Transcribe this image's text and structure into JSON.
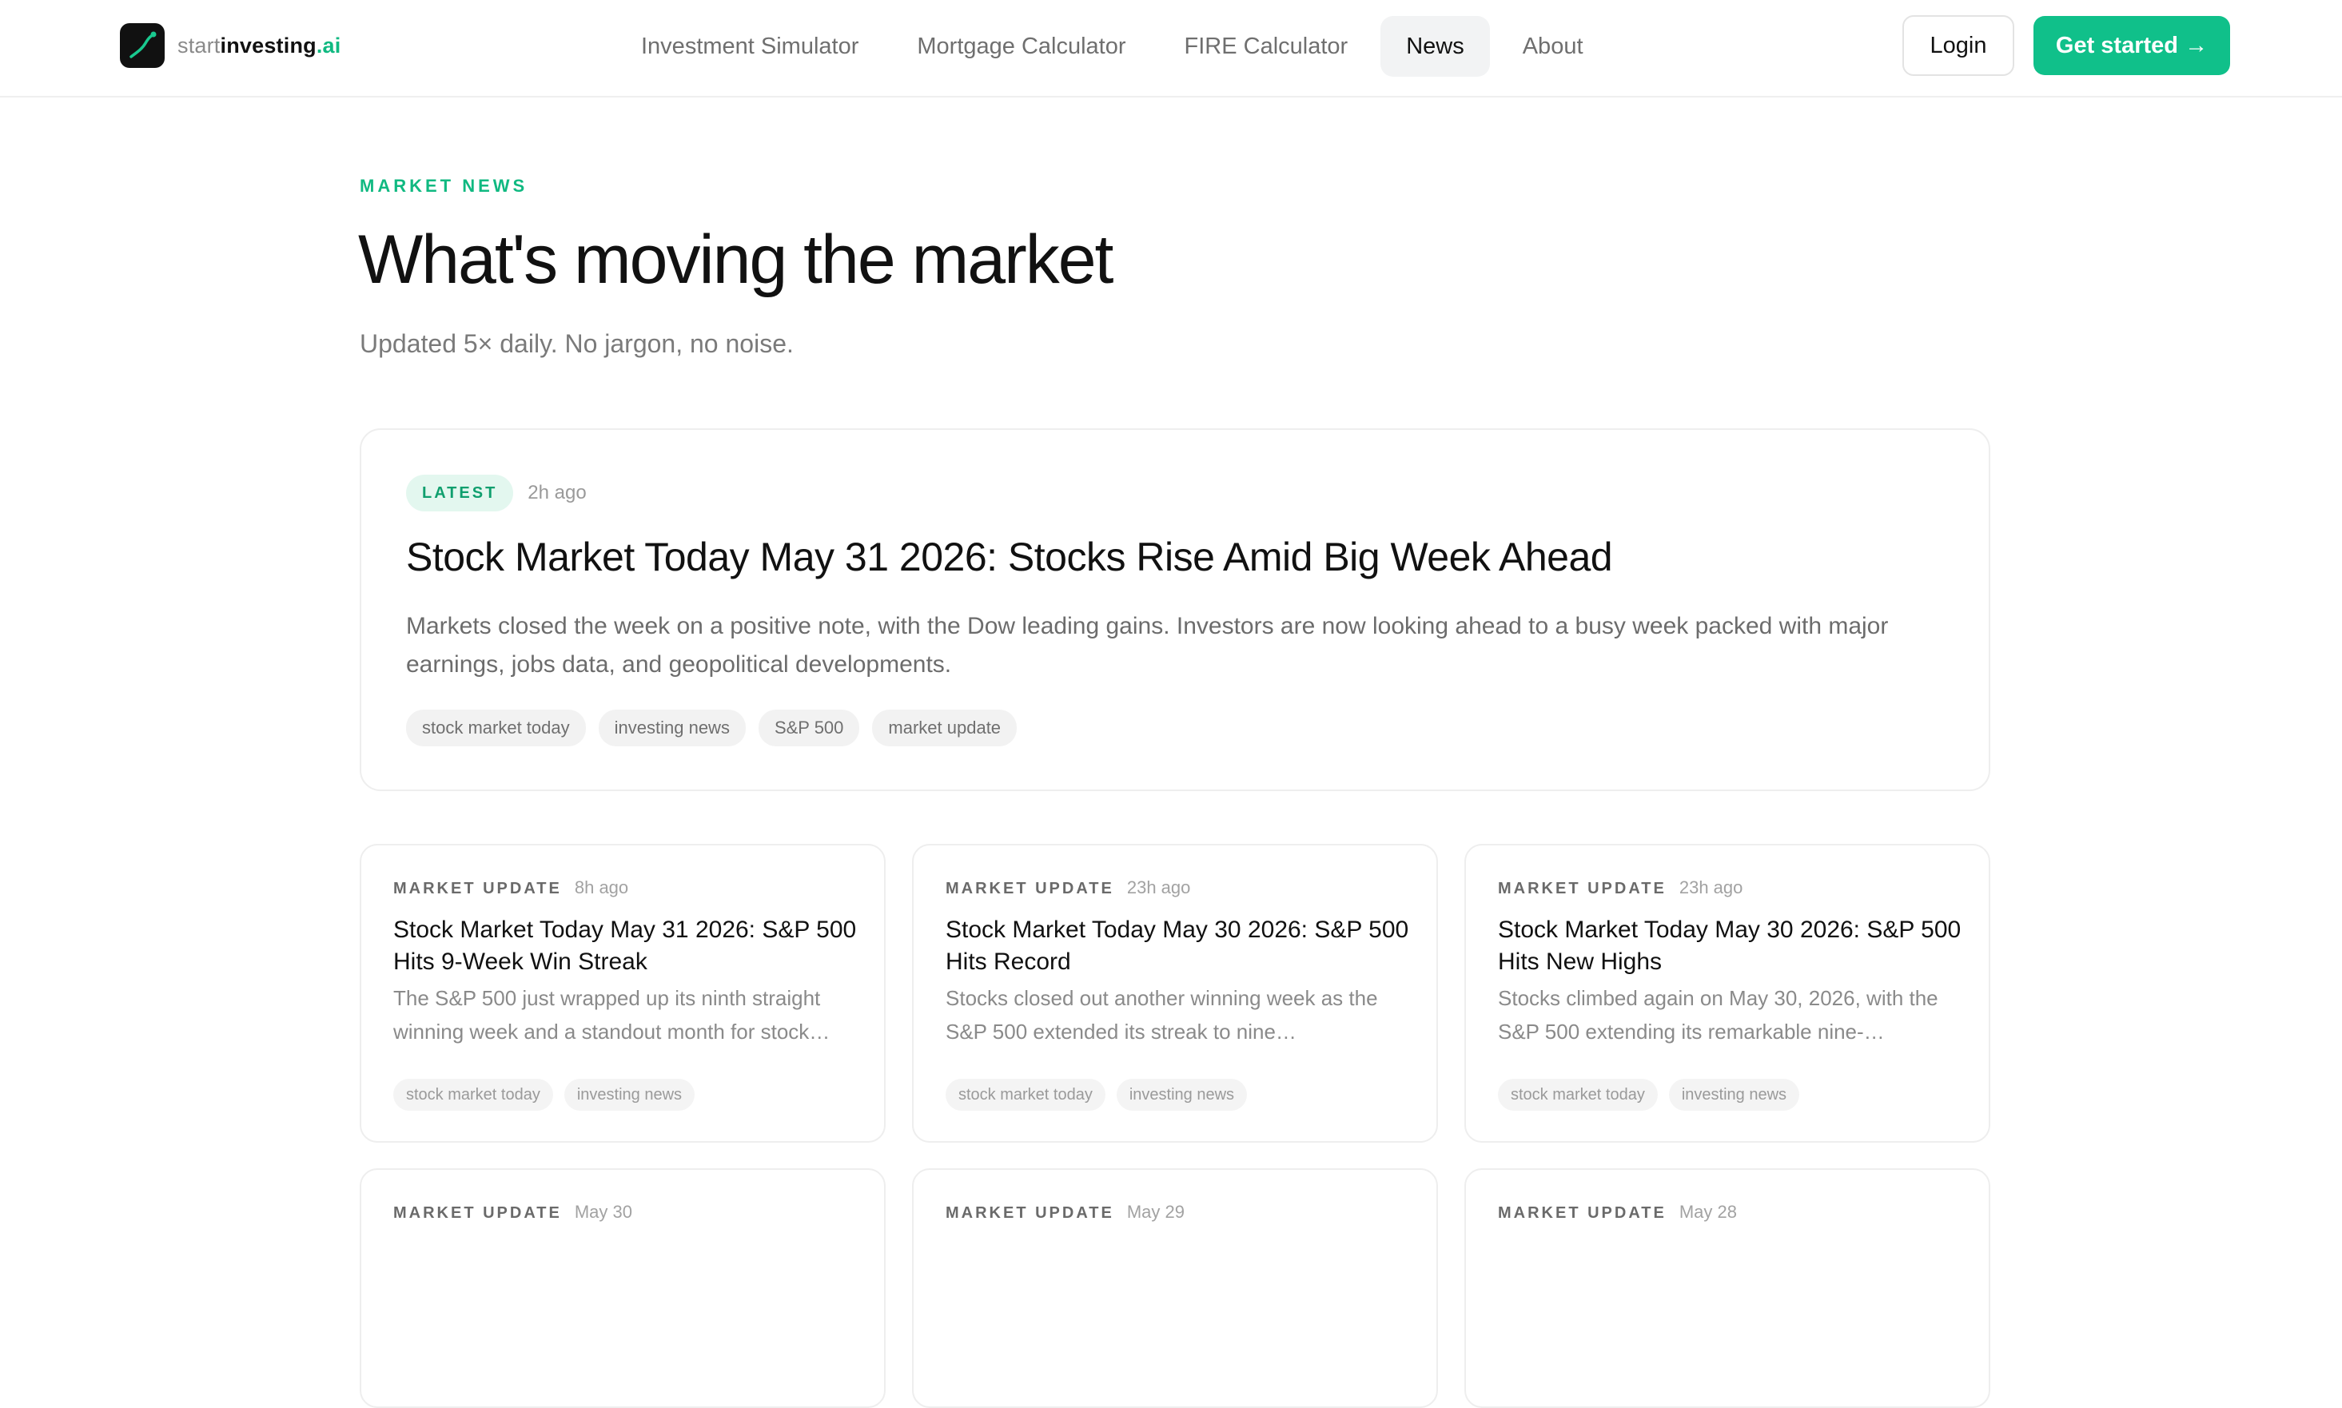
{
  "logo": {
    "start": "start",
    "investing": "investing",
    "ai": ".ai"
  },
  "nav": [
    {
      "label": "Investment Simulator",
      "active": false
    },
    {
      "label": "Mortgage Calculator",
      "active": false
    },
    {
      "label": "FIRE Calculator",
      "active": false
    },
    {
      "label": "News",
      "active": true
    },
    {
      "label": "About",
      "active": false
    }
  ],
  "header": {
    "login_label": "Login",
    "get_started_label": "Get started →"
  },
  "hero": {
    "eyebrow": "MARKET NEWS",
    "title": "What's moving the market",
    "subtitle": "Updated 5× daily. No jargon, no noise."
  },
  "featured": {
    "badge": "LATEST",
    "time": "2h ago",
    "title": "Stock Market Today May 31 2026: Stocks Rise Amid Big Week Ahead",
    "excerpt": "Markets closed the week on a positive note, with the Dow leading gains. Investors are now looking ahead to a busy week packed with major earnings, jobs data, and geopolitical developments.",
    "tags": [
      "stock market today",
      "investing news",
      "S&P 500",
      "market update"
    ]
  },
  "articles": [
    {
      "category": "MARKET UPDATE",
      "time": "8h ago",
      "title": "Stock Market Today May 31 2026: S&P 500 Hits 9-Week Win Streak",
      "excerpt": "The S&P 500 just wrapped up its ninth straight winning week and a standout month for stock…",
      "tags": [
        "stock market today",
        "investing news"
      ]
    },
    {
      "category": "MARKET UPDATE",
      "time": "23h ago",
      "title": "Stock Market Today May 30 2026: S&P 500 Hits Record",
      "excerpt": "Stocks closed out another winning week as the S&P 500 extended its streak to nine…",
      "tags": [
        "stock market today",
        "investing news"
      ]
    },
    {
      "category": "MARKET UPDATE",
      "time": "23h ago",
      "title": "Stock Market Today May 30 2026: S&P 500 Hits New Highs",
      "excerpt": "Stocks climbed again on May 30, 2026, with the S&P 500 extending its remarkable nine-…",
      "tags": [
        "stock market today",
        "investing news"
      ]
    },
    {
      "category": "MARKET UPDATE",
      "time": "May 30"
    },
    {
      "category": "MARKET UPDATE",
      "time": "May 29"
    },
    {
      "category": "MARKET UPDATE",
      "time": "May 28"
    }
  ],
  "colors": {
    "accent": "#10c08a",
    "accent_text": "#10b981",
    "badge_bg": "#e3f7ef"
  }
}
